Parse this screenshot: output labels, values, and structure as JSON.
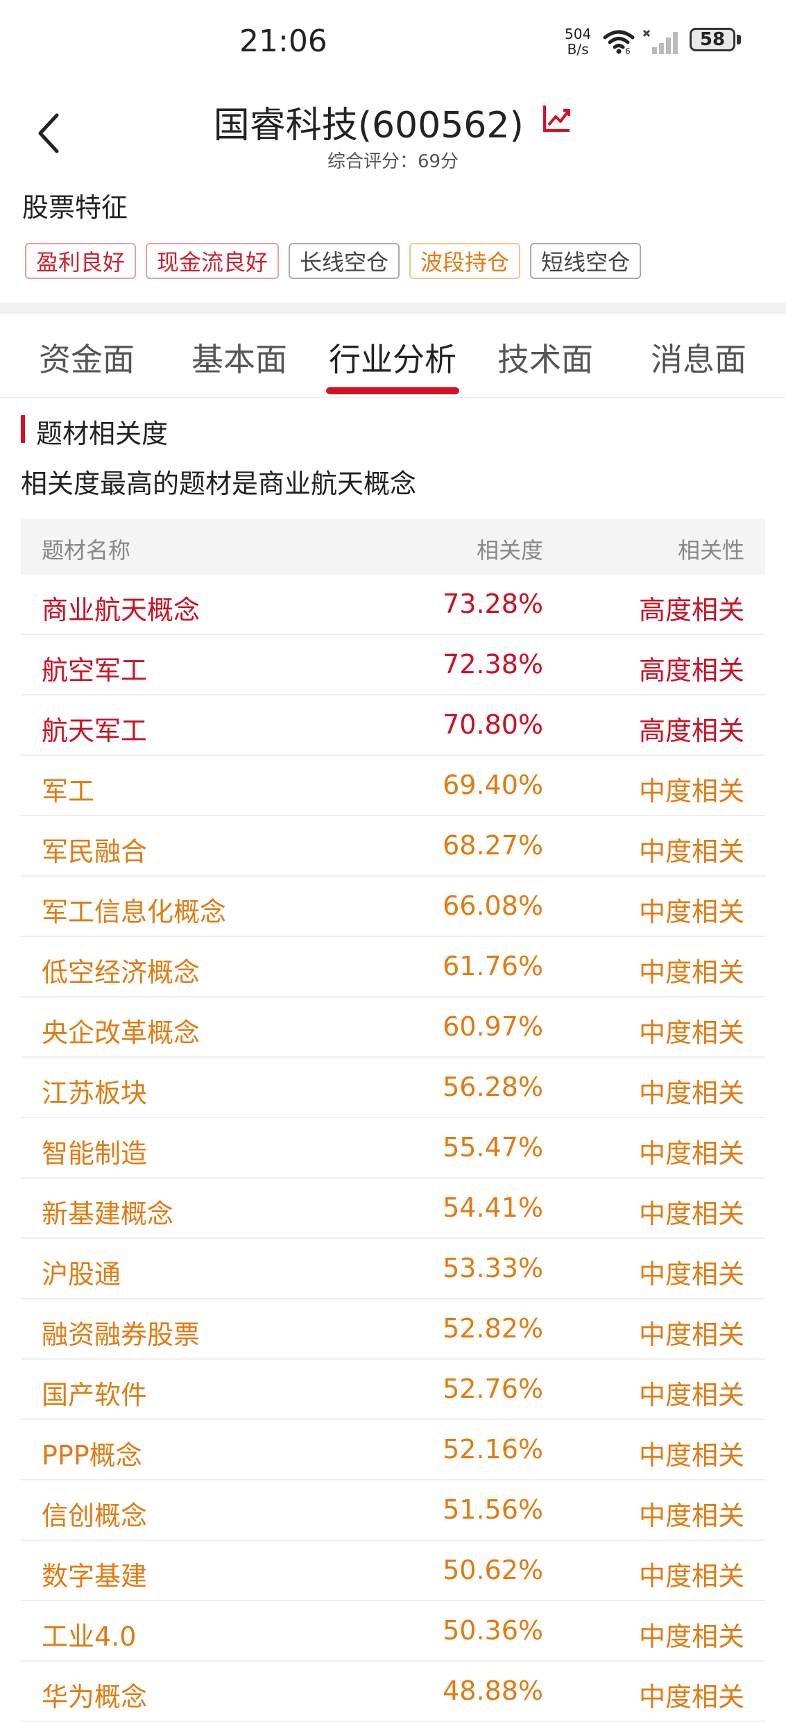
{
  "status_bar": {
    "time": "21:06",
    "net_speed_value": "504",
    "net_speed_unit": "B/s",
    "battery_level": "58"
  },
  "header": {
    "title": "国睿科技(600562)",
    "score": "综合评分：69分",
    "trend_icon": "trend-line-icon",
    "back_icon": "chevron-left-icon"
  },
  "features": {
    "title": "股票特征",
    "tags": [
      {
        "label": "盈利良好",
        "tone": "red"
      },
      {
        "label": "现金流良好",
        "tone": "red"
      },
      {
        "label": "长线空仓",
        "tone": "gray"
      },
      {
        "label": "波段持仓",
        "tone": "orange"
      },
      {
        "label": "短线空仓",
        "tone": "gray"
      }
    ]
  },
  "tabs": [
    {
      "label": "资金面",
      "active": false
    },
    {
      "label": "基本面",
      "active": false
    },
    {
      "label": "行业分析",
      "active": true
    },
    {
      "label": "技术面",
      "active": false
    },
    {
      "label": "消息面",
      "active": false
    }
  ],
  "section": {
    "title": "题材相关度",
    "summary": "相关度最高的题材是商业航天概念"
  },
  "table": {
    "headers": [
      "题材名称",
      "相关度",
      "相关性"
    ],
    "rows": [
      {
        "name": "商业航天概念",
        "degree": "73.28%",
        "relevance": "高度相关",
        "level": "high"
      },
      {
        "name": "航空军工",
        "degree": "72.38%",
        "relevance": "高度相关",
        "level": "high"
      },
      {
        "name": "航天军工",
        "degree": "70.80%",
        "relevance": "高度相关",
        "level": "high"
      },
      {
        "name": "军工",
        "degree": "69.40%",
        "relevance": "中度相关",
        "level": "mid"
      },
      {
        "name": "军民融合",
        "degree": "68.27%",
        "relevance": "中度相关",
        "level": "mid"
      },
      {
        "name": "军工信息化概念",
        "degree": "66.08%",
        "relevance": "中度相关",
        "level": "mid"
      },
      {
        "name": "低空经济概念",
        "degree": "61.76%",
        "relevance": "中度相关",
        "level": "mid"
      },
      {
        "name": "央企改革概念",
        "degree": "60.97%",
        "relevance": "中度相关",
        "level": "mid"
      },
      {
        "name": "江苏板块",
        "degree": "56.28%",
        "relevance": "中度相关",
        "level": "mid"
      },
      {
        "name": "智能制造",
        "degree": "55.47%",
        "relevance": "中度相关",
        "level": "mid"
      },
      {
        "name": "新基建概念",
        "degree": "54.41%",
        "relevance": "中度相关",
        "level": "mid"
      },
      {
        "name": "沪股通",
        "degree": "53.33%",
        "relevance": "中度相关",
        "level": "mid"
      },
      {
        "name": "融资融券股票",
        "degree": "52.82%",
        "relevance": "中度相关",
        "level": "mid"
      },
      {
        "name": "国产软件",
        "degree": "52.76%",
        "relevance": "中度相关",
        "level": "mid"
      },
      {
        "name": "PPP概念",
        "degree": "52.16%",
        "relevance": "中度相关",
        "level": "mid"
      },
      {
        "name": "信创概念",
        "degree": "51.56%",
        "relevance": "中度相关",
        "level": "mid"
      },
      {
        "name": "数字基建",
        "degree": "50.62%",
        "relevance": "中度相关",
        "level": "mid"
      },
      {
        "name": "工业4.0",
        "degree": "50.36%",
        "relevance": "中度相关",
        "level": "mid"
      },
      {
        "name": "华为概念",
        "degree": "48.88%",
        "relevance": "中度相关",
        "level": "mid"
      }
    ]
  },
  "colors": {
    "high": "#cc1023",
    "mid": "#e07b12",
    "accent": "#d80f22"
  }
}
